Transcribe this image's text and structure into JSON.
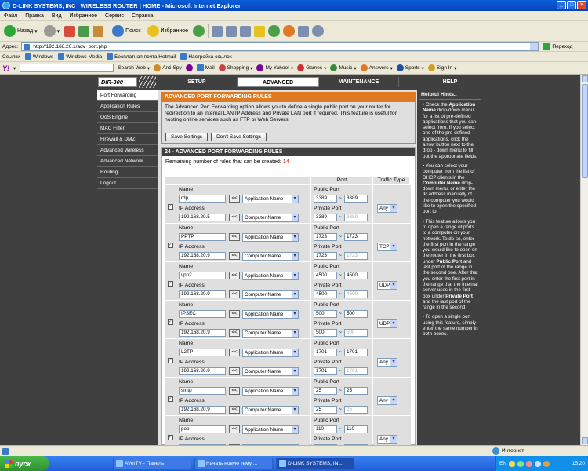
{
  "window": {
    "title": "D-LINK SYSTEMS, INC | WIRELESS ROUTER | HOME - Microsoft Internet Explorer"
  },
  "menu": [
    "Файл",
    "Правка",
    "Вид",
    "Избранное",
    "Сервис",
    "Справка"
  ],
  "toolbar": {
    "back": "Назад",
    "search": "Поиск",
    "favorites": "Избранное"
  },
  "address": {
    "label": "Адрес:",
    "url": "http://192.168.20.1/adv_port.php",
    "go": "Переход"
  },
  "links": {
    "label": "Ссылки",
    "items": [
      "Windows",
      "Windows Media",
      "Бесплатная почта Hotmail",
      "Настройка ссылок"
    ]
  },
  "yahoo": {
    "search_web": "Search Web",
    "items": [
      "Anti-Spy",
      "Mail",
      "Shopping",
      "My Yahoo!",
      "Games",
      "Music",
      "Answers",
      "Sports",
      "Sign In"
    ]
  },
  "router": {
    "model": "DIR-300",
    "tabs": [
      "SETUP",
      "ADVANCED",
      "MAINTENANCE",
      "STATUS"
    ],
    "help_tab": "HELP",
    "sidebar": [
      "Port Forwarding",
      "Application Rules",
      "QoS Engine",
      "MAC Filter",
      "Firewall & DMZ",
      "Advanced Wireless",
      "Advanced Network",
      "Routing",
      "Logout"
    ],
    "intro": {
      "title": "ADVANCED PORT FORWARDING RULES",
      "text": "The Advanced Port Forwarding option allows you to define a single public port on your router for redirection to an internal LAN IP Address and Private LAN port if required. This feature is useful for hosting online services such as FTP or Web Servers.",
      "save": "Save Settings",
      "dont_save": "Don't Save Settings"
    },
    "rules": {
      "title": "24 - ADVANCED PORT FORWARDING RULES",
      "remaining_label": "Remaining number of rules that can be created:",
      "remaining_num": "14",
      "col_port": "Port",
      "col_traffic": "Traffic Type",
      "name_label": "Name",
      "ip_label": "IP Address",
      "public_label": "Public Port",
      "private_label": "Private Port",
      "app_select": "Application Name",
      "comp_select": "Computer Name",
      "arrow": "<<",
      "tilde": "~",
      "check": "✓",
      "items": [
        {
          "name": "rdp",
          "ip": "192.168.20.5",
          "pub_from": "3389",
          "pub_to": "3389",
          "priv_from": "3389",
          "priv_to": "3389",
          "traffic": "Any"
        },
        {
          "name": "PPTP",
          "ip": "192.168.20.9",
          "pub_from": "1723",
          "pub_to": "1723",
          "priv_from": "1723",
          "priv_to": "1723",
          "traffic": "TCP"
        },
        {
          "name": "vpn2",
          "ip": "192.168.20.9",
          "pub_from": "4500",
          "pub_to": "4500",
          "priv_from": "4500",
          "priv_to": "4500",
          "traffic": "UDP"
        },
        {
          "name": "IPSEC",
          "ip": "192.168.20.9",
          "pub_from": "500",
          "pub_to": "500",
          "priv_from": "500",
          "priv_to": "500",
          "traffic": "UDP"
        },
        {
          "name": "L2TP",
          "ip": "192.168.20.9",
          "pub_from": "1701",
          "pub_to": "1701",
          "priv_from": "1701",
          "priv_to": "1701",
          "traffic": "Any"
        },
        {
          "name": "smtp",
          "ip": "192.168.20.9",
          "pub_from": "25",
          "pub_to": "25",
          "priv_from": "25",
          "priv_to": "25",
          "traffic": "Any"
        },
        {
          "name": "pop",
          "ip": "",
          "pub_from": "110",
          "pub_to": "110",
          "priv_from": "",
          "priv_to": "",
          "traffic": "Any"
        }
      ]
    },
    "help": {
      "title": "Helpful Hints..",
      "p1_a": "• Check the ",
      "p1_b": "Application Name",
      "p1_c": " drop-down menu for a list of pre-defined applications that you can select from. If you select one of the pre-defined applications, click the arrow button next to the drop - down menu to fill out the appropriate fields.",
      "p2_a": "• You can select your computer from the list of DHCP clients in the ",
      "p2_b": "Computer Name",
      "p2_c": " drop-down menu, or enter the IP address manually of the computer you would like to open the specified port to.",
      "p3_a": "• This feature allows you to open a range of ports to a computer on your network. To do so, enter the first port in the range you would like to open on the router in the first box under ",
      "p3_b": "Public Port",
      "p3_c": " and last port of the range in the second one. After that you enter the first port in the range that the internal server uses in the first box under ",
      "p3_d": "Private Port",
      "p3_e": " and the last port of the range in the second.",
      "p4": "• To open a single port using this feature, simply enter the same number in both boxes."
    }
  },
  "status": {
    "left": "",
    "zone": "Интернет"
  },
  "taskbar": {
    "start": "пуск",
    "tasks": [
      "AVerTV - Панель",
      "Начать новую тему ...",
      "D-LINK SYSTEMS, IN..."
    ],
    "lang": "EN",
    "clock": "15:20"
  }
}
